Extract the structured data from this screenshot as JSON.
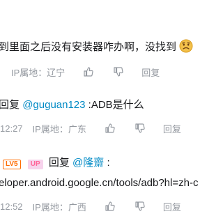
{
  "comment1": {
    "text": "到里面之后没有安装器咋办啊，没找到",
    "emoji": "sad-face-emoji",
    "ip": "IP属地：辽宁",
    "reply": "回复"
  },
  "comment2": {
    "reply_prefix": "回复",
    "mention": "@guguan123",
    "text": ":ADB是什么",
    "time": "12:27",
    "ip": "IP属地：广东",
    "reply": "回复"
  },
  "comment3": {
    "level": "LV5",
    "up_badge": "UP",
    "reply_prefix": "回复",
    "mention": "@隆齋",
    "colon": ":",
    "link": "eloper.android.google.cn/tools/adb?hl=zh-c",
    "time": "12:52",
    "ip": "IP属地：广西",
    "reply": "回复"
  },
  "colors": {
    "mention": "#008ac5",
    "meta": "#9499a0",
    "level": "#ff6c00",
    "up": "#ff6699"
  }
}
